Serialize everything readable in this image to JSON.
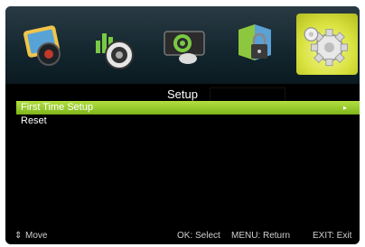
{
  "menu": {
    "title": "Setup",
    "items": [
      {
        "label": "First Time Setup",
        "selected": true,
        "arrow": "▸"
      },
      {
        "label": "Reset",
        "selected": false
      }
    ]
  },
  "icons": [
    {
      "name": "picture-icon"
    },
    {
      "name": "sound-icon"
    },
    {
      "name": "channel-icon"
    },
    {
      "name": "lock-icon"
    },
    {
      "name": "setup-gear-icon",
      "selected": true
    }
  ],
  "footer": {
    "move_glyph": "⇕",
    "move": "Move",
    "ok": "OK: Select",
    "menu": "MENU: Return",
    "exit": "EXIT: Exit"
  },
  "colors": {
    "highlight": "#9ccc2c",
    "selected_tile": "#d9e23f"
  }
}
